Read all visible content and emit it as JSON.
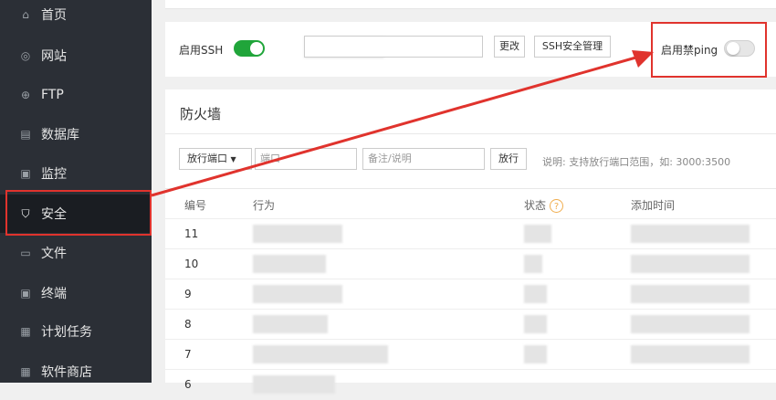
{
  "sidebar": {
    "items": [
      {
        "label": "首页",
        "icon": "home-icon",
        "glyph": "⌂"
      },
      {
        "label": "网站",
        "icon": "globe-icon",
        "glyph": "◎"
      },
      {
        "label": "FTP",
        "icon": "ftp-icon",
        "glyph": "⊕"
      },
      {
        "label": "数据库",
        "icon": "database-icon",
        "glyph": "▤"
      },
      {
        "label": "监控",
        "icon": "monitor-icon",
        "glyph": "▣"
      },
      {
        "label": "安全",
        "icon": "shield-icon",
        "glyph": "⛉"
      },
      {
        "label": "文件",
        "icon": "folder-icon",
        "glyph": "▭"
      },
      {
        "label": "终端",
        "icon": "terminal-icon",
        "glyph": "▣"
      },
      {
        "label": "计划任务",
        "icon": "calendar-icon",
        "glyph": "▦"
      },
      {
        "label": "软件商店",
        "icon": "apps-icon",
        "glyph": "▦"
      }
    ]
  },
  "ssh": {
    "enable_label": "启用SSH",
    "enabled": true,
    "change_button": "更改",
    "manage_button": "SSH安全管理",
    "ping_label": "启用禁ping",
    "ping_enabled": false
  },
  "firewall": {
    "title": "防火墙",
    "select_value": "放行端口",
    "port_placeholder": "端口",
    "remark_placeholder": "备注/说明",
    "allow_button": "放行",
    "hint": "说明: 支持放行端口范围，如: 3000:3500",
    "columns": {
      "id": "编号",
      "action": "行为",
      "status": "状态",
      "added": "添加时间"
    },
    "status_help": "?",
    "rows": [
      "11",
      "10",
      "9",
      "8",
      "7",
      "6"
    ]
  },
  "colors": {
    "accent_green": "#20a53a",
    "highlight_red": "#e0332d",
    "sidebar_bg": "#2b2f36"
  }
}
